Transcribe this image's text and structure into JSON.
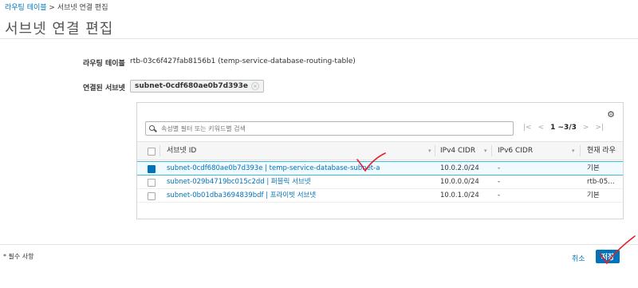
{
  "breadcrumb": {
    "parent": "라우팅 테이블",
    "separator": " > ",
    "current": "서브넷 연결 편집"
  },
  "page_title": "서브넷 연결 편집",
  "route_table": {
    "label": "라우팅 테이블",
    "value": "rtb-03c6f427fab8156b1 (temp-service-database-routing-table)"
  },
  "associated": {
    "label": "연결된 서브넷",
    "chip": "subnet-0cdf680ae0b7d393e"
  },
  "table": {
    "search_placeholder": "속성별 필터 또는 키워드별 검색",
    "pagination": "1 ~3/3",
    "columns": [
      "서브넷 ID",
      "IPv4 CIDR",
      "IPv6 CIDR",
      "현재 라우"
    ],
    "rows": [
      {
        "subnet": "subnet-0cdf680ae0b7d393e | temp-service-database-subnet-a",
        "ipv4": "10.0.2.0/24",
        "ipv6": "-",
        "route": "기본",
        "selected": true
      },
      {
        "subnet": "subnet-029b4719bc015c2dd | 퍼블릭 서브넷",
        "ipv4": "10.0.0.0/24",
        "ipv6": "-",
        "route": "rtb-05…",
        "selected": false
      },
      {
        "subnet": "subnet-0b01dba3694839bdf | 프라이빗 서브넷",
        "ipv4": "10.0.1.0/24",
        "ipv6": "-",
        "route": "기본",
        "selected": false
      }
    ]
  },
  "footer": {
    "required_note": "* 필수 사항",
    "cancel": "취소",
    "save": "저장"
  },
  "colors": {
    "accent": "#0073bb",
    "annotation": "#e0202a"
  }
}
